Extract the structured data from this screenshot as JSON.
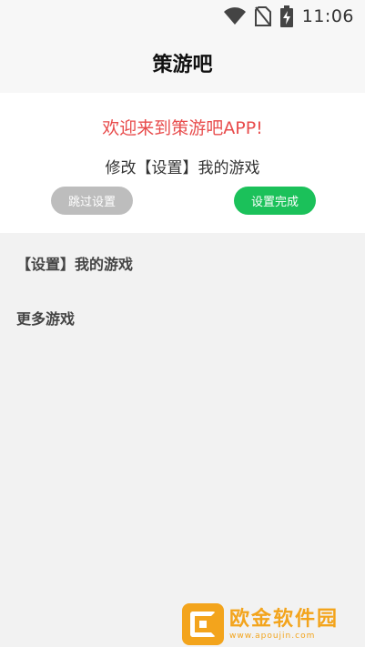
{
  "status_bar": {
    "time": "11:06",
    "icons": [
      "wifi-icon",
      "no-sim-icon",
      "battery-charging-icon"
    ]
  },
  "app_bar": {
    "title": "策游吧"
  },
  "welcome": {
    "headline": "欢迎来到策游吧APP!",
    "subtitle": "修改【设置】我的游戏",
    "skip_label": "跳过设置",
    "done_label": "设置完成"
  },
  "sections": {
    "my_games": "【设置】我的游戏",
    "more_games": "更多游戏"
  },
  "watermark": {
    "title": "欧金软件园",
    "url": "www.apoujin.com"
  },
  "colors": {
    "headline_red": "#e84c4c",
    "done_green": "#1bc15a",
    "skip_gray": "#bdbdbd",
    "watermark_orange": "#f3a41c"
  }
}
